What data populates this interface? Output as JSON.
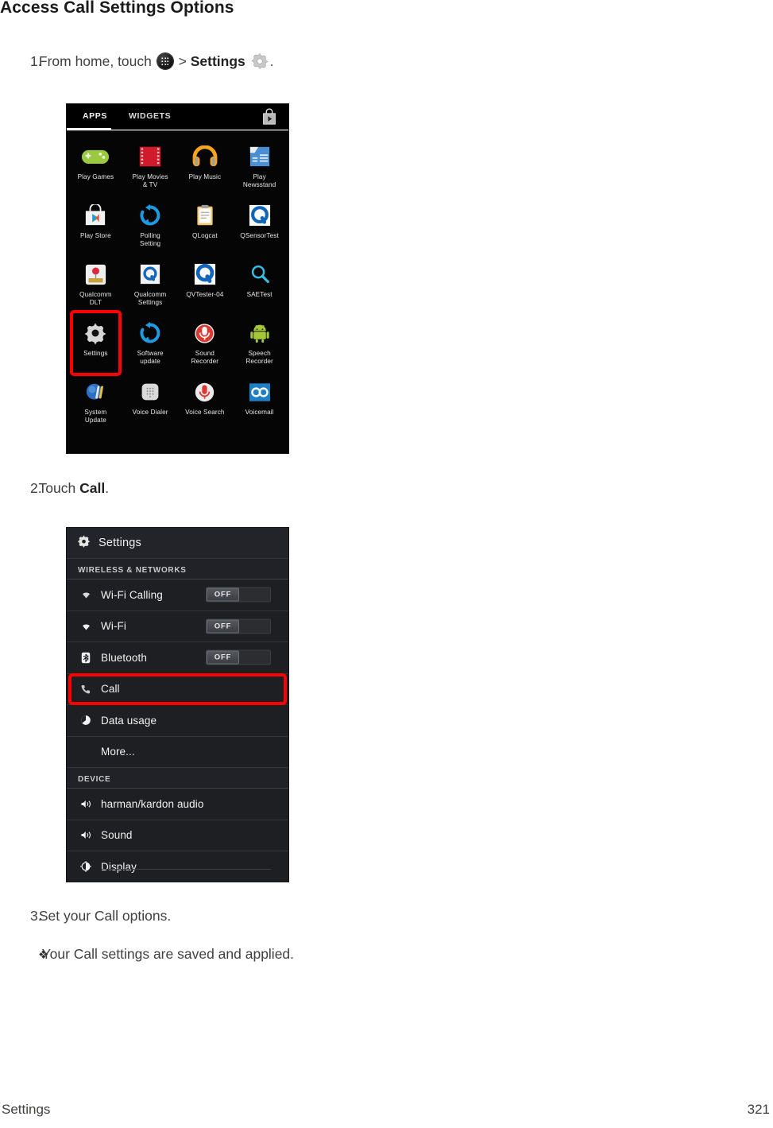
{
  "document": {
    "title": "Access Call Settings Options",
    "footer_left": "Settings",
    "footer_page": "321"
  },
  "steps": [
    {
      "number": "1.",
      "text_before": "From home, touch",
      "icon_1": "apps-grid-icon",
      "separator": ">",
      "bold_text": "Settings",
      "icon_2": "gear-icon",
      "text_after": "."
    },
    {
      "number": "2.",
      "text_before": "Touch",
      "bold_text": "Call",
      "text_after": "."
    },
    {
      "number": "3.",
      "text_before": "Set your Call options."
    }
  ],
  "bullet": {
    "glyph": "❖",
    "text": "Your Call settings are saved and applied."
  },
  "apps_drawer": {
    "tabs": [
      {
        "label": "APPS",
        "selected": true
      },
      {
        "label": "WIDGETS",
        "selected": false
      }
    ],
    "store_icon": "play-store-bag-icon",
    "highlight_color": "#ff0000",
    "highlighted_app": "Settings",
    "rows": [
      [
        {
          "label": "Play Games",
          "icon": "play-games-icon"
        },
        {
          "label": "Play Movies\n& TV",
          "icon": "play-movies-icon"
        },
        {
          "label": "Play Music",
          "icon": "play-music-icon"
        },
        {
          "label": "Play\nNewsstand",
          "icon": "play-newsstand-icon"
        }
      ],
      [
        {
          "label": "Play Store",
          "icon": "play-store-icon"
        },
        {
          "label": "Polling\nSetting",
          "icon": "polling-setting-icon"
        },
        {
          "label": "QLogcat",
          "icon": "qlogcat-icon"
        },
        {
          "label": "QSensorTest",
          "icon": "qsensortest-icon"
        }
      ],
      [
        {
          "label": "Qualcomm\nDLT",
          "icon": "qualcomm-dlt-icon"
        },
        {
          "label": "Qualcomm\nSettings",
          "icon": "qualcomm-settings-icon"
        },
        {
          "label": "QVTester-04",
          "icon": "qvtester-icon"
        },
        {
          "label": "SAETest",
          "icon": "saetest-search-icon"
        }
      ],
      [
        {
          "label": "Settings",
          "icon": "settings-gear-icon"
        },
        {
          "label": "Software\nupdate",
          "icon": "software-update-icon"
        },
        {
          "label": "Sound\nRecorder",
          "icon": "sound-recorder-icon"
        },
        {
          "label": "Speech\nRecorder",
          "icon": "speech-recorder-icon"
        }
      ],
      [
        {
          "label": "System\nUpdate",
          "icon": "system-update-icon"
        },
        {
          "label": "Voice Dialer",
          "icon": "voice-dialer-icon"
        },
        {
          "label": "Voice Search",
          "icon": "voice-search-icon"
        },
        {
          "label": "Voicemail",
          "icon": "voicemail-icon"
        }
      ]
    ]
  },
  "settings_screen": {
    "title": "Settings",
    "title_icon": "settings-gear-icon",
    "highlight_color": "#ff0000",
    "highlighted_row": "Call",
    "sections": [
      {
        "header": "WIRELESS & NETWORKS",
        "rows": [
          {
            "label": "Wi-Fi Calling",
            "icon": "wifi-icon",
            "toggle": "OFF"
          },
          {
            "label": "Wi-Fi",
            "icon": "wifi-icon",
            "toggle": "OFF"
          },
          {
            "label": "Bluetooth",
            "icon": "bluetooth-icon",
            "toggle": "OFF"
          },
          {
            "label": "Call",
            "icon": "phone-icon",
            "toggle": null,
            "highlighted": true
          },
          {
            "label": "Data usage",
            "icon": "data-usage-icon",
            "toggle": null
          },
          {
            "label": "More...",
            "icon": null,
            "toggle": null,
            "indent": true
          }
        ]
      },
      {
        "header": "DEVICE",
        "rows": [
          {
            "label": "harman/kardon audio",
            "icon": "speaker-icon",
            "toggle": null
          },
          {
            "label": "Sound",
            "icon": "speaker-icon",
            "toggle": null
          },
          {
            "label": "Display",
            "icon": "display-brightness-icon",
            "toggle": null
          }
        ]
      }
    ]
  }
}
